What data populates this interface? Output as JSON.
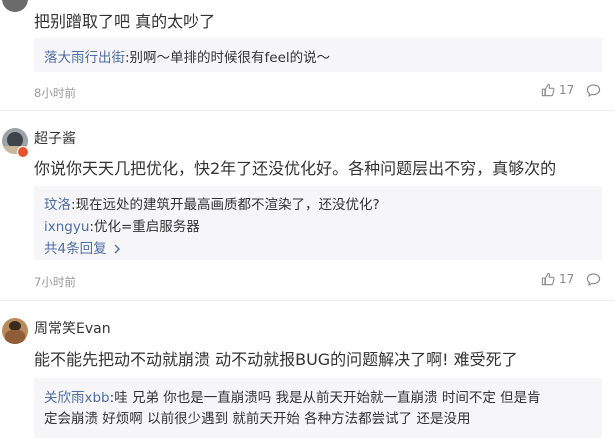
{
  "comments": [
    {
      "text": "把别蹭取了吧 真的太吵了",
      "replies": [
        {
          "user": "落大雨行出街",
          "text": ":别啊～单排的时候很有feel的说～"
        }
      ],
      "time": "8小时前",
      "likes": "17"
    },
    {
      "username": "超子酱",
      "text": "你说你天天几把优化，快2年了还没优化好。各种问题层出不穷，真够次的",
      "replies": [
        {
          "user": "玟洛",
          "text": ":现在远处的建筑开最高画质都不渲染了，还没优化?"
        },
        {
          "user": "ixngyu",
          "text": ":优化=重启服务器"
        }
      ],
      "more": "共4条回复",
      "time": "7小时前",
      "likes": "17"
    },
    {
      "username": "周常笑Evan",
      "text": "能不能先把动不动就崩溃 动不动就报BUG的问题解决了啊! 难受死了",
      "replies": [
        {
          "user": "关欣雨xbb",
          "text_line1": ":哇 兄弟 你也是一直崩溃吗 我是从前天开始就一直崩溃 时间不定 但是肯",
          "text_line2": "定会崩溃 好烦啊 以前很少遇到 就前天开始 各种方法都尝试了 还是没用"
        }
      ]
    }
  ],
  "icons": {
    "like": "thumbs-up-icon",
    "comment": "comment-bubble-icon",
    "more_arrow": "chevron-right-icon"
  },
  "colors": {
    "link": "#4e6ea3",
    "reply_bg": "#f6f6f8",
    "meta": "#999999"
  }
}
